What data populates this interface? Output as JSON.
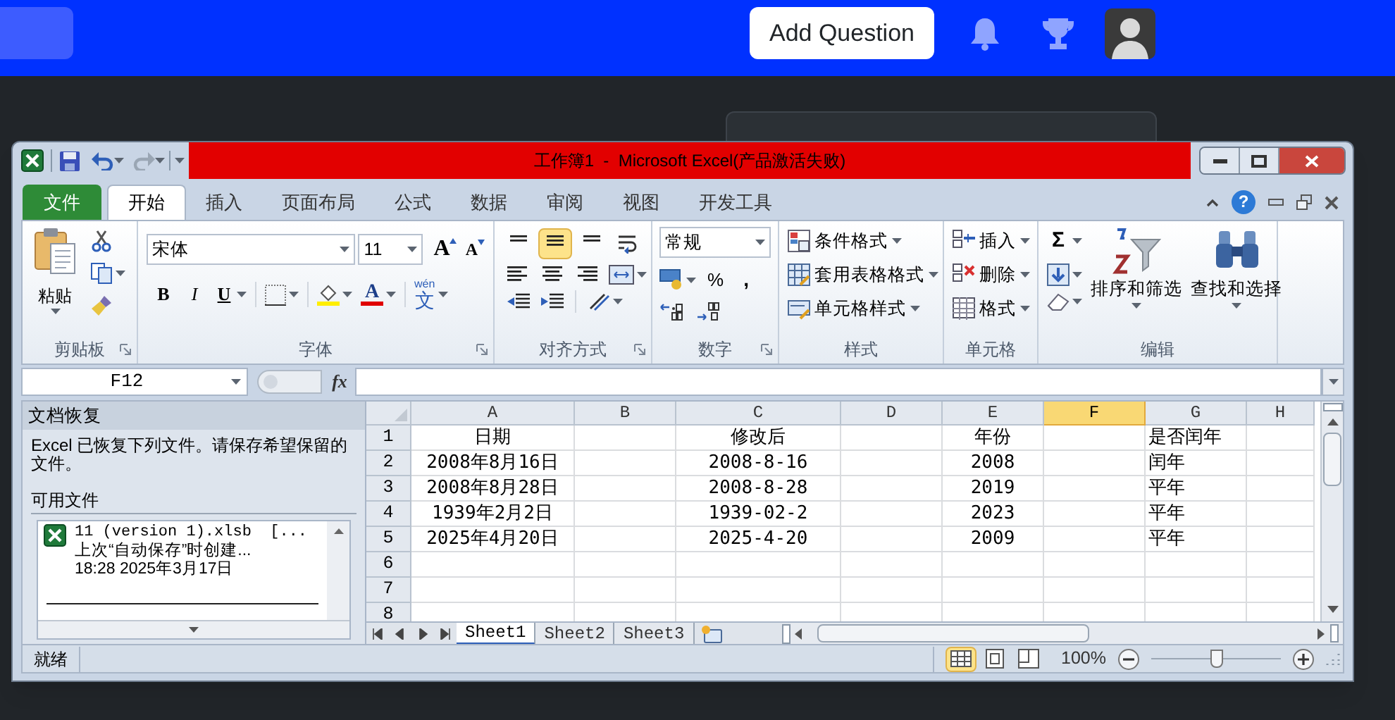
{
  "nav": {
    "add_question": "Add Question"
  },
  "excel": {
    "title": "工作簿1  -  Microsoft Excel(产品激活失败)",
    "help": "?",
    "tabs": [
      {
        "label": "文件",
        "kind": "file",
        "selected": false
      },
      {
        "label": "开始",
        "kind": "tab",
        "selected": true
      },
      {
        "label": "插入",
        "kind": "tab",
        "selected": false
      },
      {
        "label": "页面布局",
        "kind": "tab",
        "selected": false
      },
      {
        "label": "公式",
        "kind": "tab",
        "selected": false
      },
      {
        "label": "数据",
        "kind": "tab",
        "selected": false
      },
      {
        "label": "审阅",
        "kind": "tab",
        "selected": false
      },
      {
        "label": "视图",
        "kind": "tab",
        "selected": false
      },
      {
        "label": "开发工具",
        "kind": "tab",
        "selected": false
      }
    ],
    "clipboard": {
      "paste": "粘贴",
      "label": "剪贴板"
    },
    "font": {
      "name": "宋体",
      "size": "11",
      "grow": "A",
      "shrink": "A",
      "bold": "B",
      "italic": "I",
      "underline": "U",
      "color_button": "A",
      "phonetic_hint": "wén",
      "phonetic": "文",
      "label": "字体"
    },
    "alignment": {
      "vertical": [
        {
          "selected": false
        },
        {
          "selected": true
        },
        {
          "selected": false
        }
      ],
      "label": "对齐方式"
    },
    "number": {
      "format": "常规",
      "percent": "%",
      "comma": ",",
      "label": "数字"
    },
    "styles": {
      "items": [
        "条件格式",
        "套用表格格式",
        "单元格样式"
      ],
      "label": "样式"
    },
    "cells": {
      "items": [
        "插入",
        "删除",
        "格式"
      ],
      "label": "单元格"
    },
    "editing": {
      "sum": "Σ",
      "sort": "排序和筛选",
      "find": "查找和选择",
      "label": "编辑"
    },
    "name_box": "F12",
    "fx": "fx",
    "recovery": {
      "title": "文档恢复",
      "message": "Excel 已恢复下列文件。请保存希望保留的文件。",
      "section": "可用文件",
      "files": [
        {
          "name": "11 (version 1).xlsb  [...",
          "note": "上次“自动保存”时创建...",
          "time": "18:28 2025年3月17日"
        }
      ]
    },
    "columns": [
      {
        "label": "A",
        "selected": false
      },
      {
        "label": "B",
        "selected": false
      },
      {
        "label": "C",
        "selected": false
      },
      {
        "label": "D",
        "selected": false
      },
      {
        "label": "E",
        "selected": false
      },
      {
        "label": "F",
        "selected": true
      },
      {
        "label": "G",
        "selected": false
      },
      {
        "label": "H",
        "selected": false
      }
    ],
    "rows": [
      {
        "number": "1",
        "cells": {
          "A": "日期",
          "C": "修改后",
          "E": "年份",
          "G": "是否闰年"
        }
      },
      {
        "number": "2",
        "cells": {
          "A": "2008年8月16日",
          "C": "2008-8-16",
          "E": "2008",
          "G": "闰年"
        }
      },
      {
        "number": "3",
        "cells": {
          "A": "2008年8月28日",
          "C": "2008-8-28",
          "E": "2019",
          "G": "平年"
        }
      },
      {
        "number": "4",
        "cells": {
          "A": "1939年2月2日",
          "C": "1939-02-2",
          "E": "2023",
          "G": "平年"
        }
      },
      {
        "number": "5",
        "cells": {
          "A": "2025年4月20日",
          "C": "2025-4-20",
          "E": "2009",
          "G": "平年"
        }
      },
      {
        "number": "6"
      },
      {
        "number": "7"
      },
      {
        "number": "8"
      }
    ],
    "sheets": [
      {
        "label": "Sheet1",
        "selected": true
      },
      {
        "label": "Sheet2",
        "selected": false
      },
      {
        "label": "Sheet3",
        "selected": false
      }
    ],
    "status": "就绪",
    "views": [
      {
        "selected": true
      },
      {
        "selected": false
      },
      {
        "selected": false
      }
    ],
    "zoom": {
      "reading": "100%",
      "level": 0.5
    }
  }
}
